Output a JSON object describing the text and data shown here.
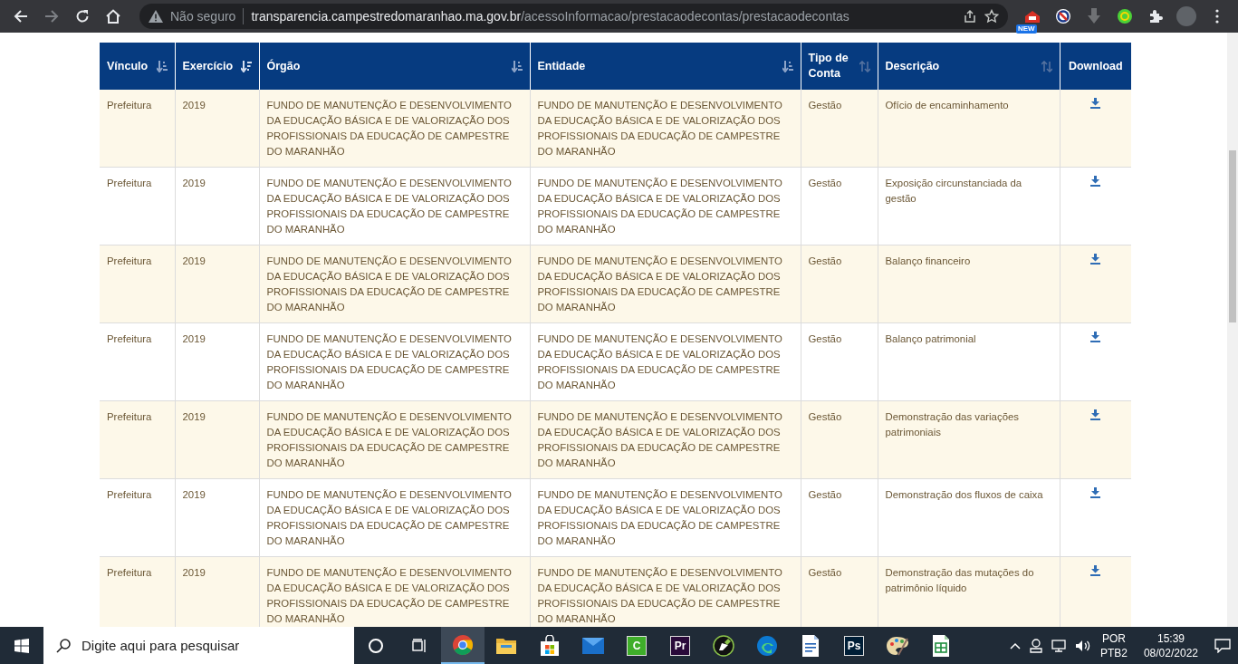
{
  "browser": {
    "security_label": "Não seguro",
    "url_host": "transparencia.campestredomaranhao.ma.gov.br",
    "url_path": "/acessoInformacao/prestacaodecontas/prestacaodecontas",
    "extension_badge": "NEW"
  },
  "table": {
    "columns": [
      {
        "label": "Vínculo",
        "kind": "ascending"
      },
      {
        "label": "Exercício",
        "kind": "descending"
      },
      {
        "label": "Órgão",
        "kind": "ascending"
      },
      {
        "label": "Entidade",
        "kind": "ascending"
      },
      {
        "label": "Tipo de Conta",
        "kind": "unsorted"
      },
      {
        "label": "Descrição",
        "kind": "unsorted"
      },
      {
        "label": "Download",
        "kind": "plain"
      }
    ],
    "rows": [
      {
        "vinculo": "Prefeitura",
        "exercicio": "2019",
        "orgao": "FUNDO DE MANUTENÇÃO E DESENVOLVIMENTO DA EDUCAÇÃO BÁSICA E DE VALORIZAÇÃO DOS PROFISSIONAIS DA EDUCAÇÃO DE CAMPESTRE DO MARANHÃO",
        "entidade": "FUNDO DE MANUTENÇÃO E DESENVOLVIMENTO DA EDUCAÇÃO BÁSICA E DE VALORIZAÇÃO DOS PROFISSIONAIS DA EDUCAÇÃO DE CAMPESTRE DO MARANHÃO",
        "tipo": "Gestão",
        "descricao": "Ofício de encaminhamento"
      },
      {
        "vinculo": "Prefeitura",
        "exercicio": "2019",
        "orgao": "FUNDO DE MANUTENÇÃO E DESENVOLVIMENTO DA EDUCAÇÃO BÁSICA E DE VALORIZAÇÃO DOS PROFISSIONAIS DA EDUCAÇÃO DE CAMPESTRE DO MARANHÃO",
        "entidade": "FUNDO DE MANUTENÇÃO E DESENVOLVIMENTO DA EDUCAÇÃO BÁSICA E DE VALORIZAÇÃO DOS PROFISSIONAIS DA EDUCAÇÃO DE CAMPESTRE DO MARANHÃO",
        "tipo": "Gestão",
        "descricao": "Exposição circunstanciada da gestão"
      },
      {
        "vinculo": "Prefeitura",
        "exercicio": "2019",
        "orgao": "FUNDO DE MANUTENÇÃO E DESENVOLVIMENTO DA EDUCAÇÃO BÁSICA E DE VALORIZAÇÃO DOS PROFISSIONAIS DA EDUCAÇÃO DE CAMPESTRE DO MARANHÃO",
        "entidade": "FUNDO DE MANUTENÇÃO E DESENVOLVIMENTO DA EDUCAÇÃO BÁSICA E DE VALORIZAÇÃO DOS PROFISSIONAIS DA EDUCAÇÃO DE CAMPESTRE DO MARANHÃO",
        "tipo": "Gestão",
        "descricao": "Balanço financeiro"
      },
      {
        "vinculo": "Prefeitura",
        "exercicio": "2019",
        "orgao": "FUNDO DE MANUTENÇÃO E DESENVOLVIMENTO DA EDUCAÇÃO BÁSICA E DE VALORIZAÇÃO DOS PROFISSIONAIS DA EDUCAÇÃO DE CAMPESTRE DO MARANHÃO",
        "entidade": "FUNDO DE MANUTENÇÃO E DESENVOLVIMENTO DA EDUCAÇÃO BÁSICA E DE VALORIZAÇÃO DOS PROFISSIONAIS DA EDUCAÇÃO DE CAMPESTRE DO MARANHÃO",
        "tipo": "Gestão",
        "descricao": "Balanço patrimonial"
      },
      {
        "vinculo": "Prefeitura",
        "exercicio": "2019",
        "orgao": "FUNDO DE MANUTENÇÃO E DESENVOLVIMENTO DA EDUCAÇÃO BÁSICA E DE VALORIZAÇÃO DOS PROFISSIONAIS DA EDUCAÇÃO DE CAMPESTRE DO MARANHÃO",
        "entidade": "FUNDO DE MANUTENÇÃO E DESENVOLVIMENTO DA EDUCAÇÃO BÁSICA E DE VALORIZAÇÃO DOS PROFISSIONAIS DA EDUCAÇÃO DE CAMPESTRE DO MARANHÃO",
        "tipo": "Gestão",
        "descricao": "Demonstração das variações patrimoniais"
      },
      {
        "vinculo": "Prefeitura",
        "exercicio": "2019",
        "orgao": "FUNDO DE MANUTENÇÃO E DESENVOLVIMENTO DA EDUCAÇÃO BÁSICA E DE VALORIZAÇÃO DOS PROFISSIONAIS DA EDUCAÇÃO DE CAMPESTRE DO MARANHÃO",
        "entidade": "FUNDO DE MANUTENÇÃO E DESENVOLVIMENTO DA EDUCAÇÃO BÁSICA E DE VALORIZAÇÃO DOS PROFISSIONAIS DA EDUCAÇÃO DE CAMPESTRE DO MARANHÃO",
        "tipo": "Gestão",
        "descricao": "Demonstração dos fluxos de caixa"
      },
      {
        "vinculo": "Prefeitura",
        "exercicio": "2019",
        "orgao": "FUNDO DE MANUTENÇÃO E DESENVOLVIMENTO DA EDUCAÇÃO BÁSICA E DE VALORIZAÇÃO DOS PROFISSIONAIS DA EDUCAÇÃO DE CAMPESTRE DO MARANHÃO",
        "entidade": "FUNDO DE MANUTENÇÃO E DESENVOLVIMENTO DA EDUCAÇÃO BÁSICA E DE VALORIZAÇÃO DOS PROFISSIONAIS DA EDUCAÇÃO DE CAMPESTRE DO MARANHÃO",
        "tipo": "Gestão",
        "descricao": "Demonstração das mutações do patrimônio líquido"
      }
    ]
  },
  "taskbar": {
    "search_placeholder": "Digite aqui para pesquisar",
    "apps": [
      {
        "kind": "chrome",
        "active": true
      },
      {
        "kind": "folder",
        "active": false
      },
      {
        "kind": "store",
        "active": false
      },
      {
        "kind": "mail",
        "active": false
      },
      {
        "kind": "letter",
        "label": "C",
        "color": "#3fae2a",
        "active": false
      },
      {
        "kind": "letter",
        "label": "Pr",
        "color": "#2a0a3a",
        "active": false
      },
      {
        "kind": "pen",
        "active": false
      },
      {
        "kind": "edge",
        "active": false
      },
      {
        "kind": "document",
        "active": false
      },
      {
        "kind": "letter",
        "label": "Ps",
        "color": "#001e36",
        "active": false
      },
      {
        "kind": "palette",
        "active": false
      },
      {
        "kind": "sheet",
        "active": false
      }
    ],
    "language": "POR",
    "layout": "PTB2",
    "time": "15:39",
    "date": "08/02/2022"
  }
}
